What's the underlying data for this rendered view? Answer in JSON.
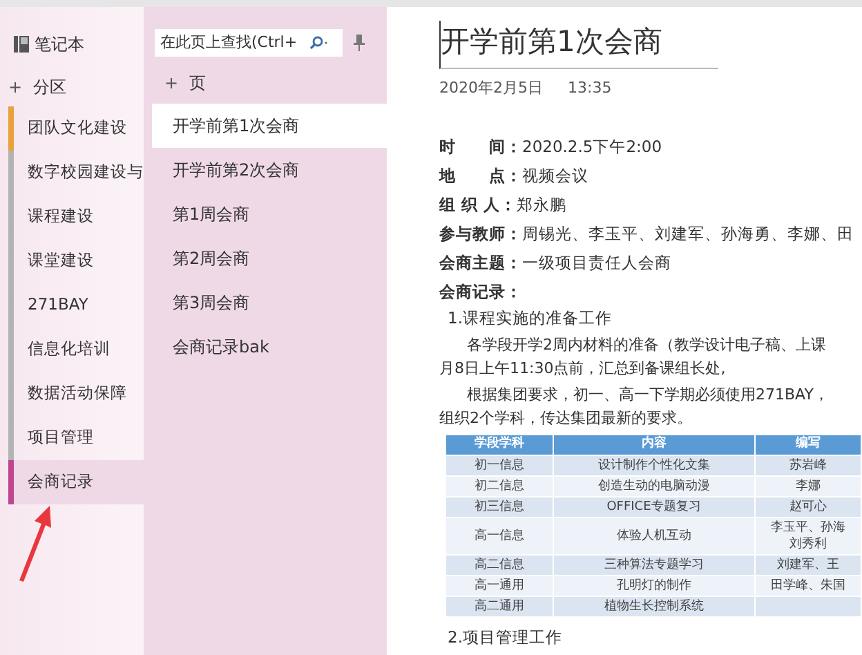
{
  "notebook": {
    "title": "笔记本"
  },
  "sections_header": {
    "add_label": "+",
    "label": "分区"
  },
  "sections": [
    {
      "label": "团队文化建设",
      "color": "#e8a33a",
      "selected": false
    },
    {
      "label": "数字校园建设与",
      "color": "#b3b3b3",
      "selected": false
    },
    {
      "label": "课程建设",
      "color": "#b3b3b3",
      "selected": false
    },
    {
      "label": "课堂建设",
      "color": "#b3b3b3",
      "selected": false
    },
    {
      "label": "271BAY",
      "color": "#b3b3b3",
      "selected": false
    },
    {
      "label": "信息化培训",
      "color": "#b3b3b3",
      "selected": false
    },
    {
      "label": "数据活动保障",
      "color": "#b3b3b3",
      "selected": false
    },
    {
      "label": "项目管理",
      "color": "#b3b3b3",
      "selected": false
    },
    {
      "label": "会商记录",
      "color": "#c0458f",
      "selected": true
    }
  ],
  "search": {
    "placeholder": "在此页上查找(Ctrl+"
  },
  "pages_header": {
    "add_label": "+",
    "label": "页"
  },
  "pages": [
    {
      "label": "开学前第1次会商",
      "selected": true
    },
    {
      "label": "开学前第2次会商",
      "selected": false
    },
    {
      "label": "第1周会商",
      "selected": false
    },
    {
      "label": "第2周会商",
      "selected": false
    },
    {
      "label": "第3周会商",
      "selected": false
    },
    {
      "label": "会商记录bak",
      "selected": false
    }
  ],
  "page": {
    "title": "开学前第1次会商",
    "date": "2020年2月5日",
    "time": "13:35",
    "fields": [
      {
        "label": "时　　间：",
        "value": "2020.2.5下午2:00"
      },
      {
        "label": "地　　点：",
        "value": "视频会议"
      },
      {
        "label": "组 织 人：",
        "value": "郑永鹏"
      },
      {
        "label": "参与教师：",
        "value": "周锡光、李玉平、刘建军、孙海勇、李娜、田"
      },
      {
        "label": "会商主题：",
        "value": "一级项目责任人会商"
      },
      {
        "label": "会商记录："
      }
    ],
    "item1": "1.课程实施的准备工作",
    "paragraphs": [
      [
        "各学段开学2周内材料的准备（教学设计电子稿、上课",
        "月8日上午11:30点前，汇总到备课组长处,"
      ],
      [
        "根据集团要求，初一、高一下学期必须使用271BAY，",
        "组织2个学科，传达集团最新的要求。"
      ]
    ],
    "table": {
      "columns": [
        "学段学科",
        "内容",
        "编写"
      ],
      "rows": [
        [
          [
            "初一信息"
          ],
          [
            "设计制作个性化文集"
          ],
          [
            "苏岩峰"
          ]
        ],
        [
          [
            "初二信息"
          ],
          [
            "创造生动的电脑动漫"
          ],
          [
            "李娜"
          ]
        ],
        [
          [
            "初三信息"
          ],
          [
            "OFFICE专题复习"
          ],
          [
            "赵可心"
          ]
        ],
        [
          [
            "高一信息"
          ],
          [
            "体验人机互动"
          ],
          [
            "李玉平、孙海",
            "刘秀利"
          ]
        ],
        [
          [
            "高二信息"
          ],
          [
            "三种算法专题学习"
          ],
          [
            "刘建军、王"
          ]
        ],
        [
          [
            "高一通用"
          ],
          [
            "孔明灯的制作"
          ],
          [
            "田学峰、朱国"
          ]
        ],
        [
          [
            "高二通用"
          ],
          [
            "植物生长控制系统"
          ]
        ]
      ]
    },
    "item2": "2.项目管理工作"
  }
}
